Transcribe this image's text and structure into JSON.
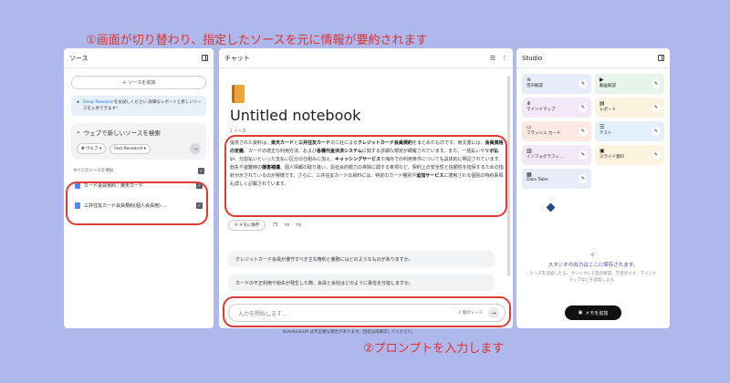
{
  "captions": {
    "top": "①画面が切り替わり、指定したソースを元に情報が要約されます",
    "bottom": "②プロンプトを入力します"
  },
  "sources_panel": {
    "title": "ソース",
    "add_button": "＋ ソースを追加",
    "deep_research": {
      "link": "Deep Research",
      "text": "をお試しください 詳細なレポートと新しいソースを入手できます！"
    },
    "search_title": "ウェブで新しいソースを検索",
    "web_chip": "ウェブ",
    "research_chip": "Fast Research",
    "select_all": "すべてのソースを選択",
    "items": [
      {
        "label": "カード会員規約｜楽天カード"
      },
      {
        "label": "三井住友カード会員規約(個人会員用) ..."
      }
    ]
  },
  "chat_panel": {
    "title": "チャット",
    "notebook_title": "Untitled notebook",
    "source_count": "2 ソース",
    "summary_html": "提供された資料は、<b>楽天カード</b>と<b>三井住友カード</b>の二社による<b>クレジットカード会員規約</b>をまとめたものです。両文書には、<b>会員資格の定義</b>、カードの適正な利用方法、および<b>各種代金決済システム</b>に関する詳細な規定が網羅されています。また、一括払いや<b>リボ払い</b>、分割払いといった支払い区分の仕組みに加え、<b>キャッシングサービス</b>や海外での利用条件についても具体的に明記されています。紛失や盗難時の<b>損害補償</b>、個人情報の取り扱い、反社会的勢力の排除に関する条項など、契約上の安全性と信頼性を担保するための指針が示されているのが特徴です。さらに、三井住友カードの資料には、特定のカード種別や<b>追加サービス</b>に適用される個別の特約事項も詳しく記載されています。",
    "save_memo": "メモに保存",
    "questions": [
      "クレジットカード会員が遵守すべき主な権利と義務にはどのようなものがありますか。",
      "カードの不正利用や紛失が発生した際、会員と会社はどのように責任を分担しますか。"
    ],
    "input_placeholder": "入力を開始します...",
    "input_count": "2 個のソース"
  },
  "studio_panel": {
    "title": "Studio",
    "tiles": [
      {
        "icon": "waveform-icon",
        "label": "音声解説",
        "color": "#e8ecf8"
      },
      {
        "icon": "video-icon",
        "label": "動画解説",
        "color": "#e6f4ea"
      },
      {
        "icon": "mindmap-icon",
        "label": "マインドマップ",
        "color": "#f3e8f7"
      },
      {
        "icon": "report-icon",
        "label": "レポート",
        "color": "#fbf3dd"
      },
      {
        "icon": "flashcard-icon",
        "label": "フラッシュ カード",
        "color": "#fde8e4"
      },
      {
        "icon": "quiz-icon",
        "label": "テスト",
        "color": "#e3f0fb"
      },
      {
        "icon": "infographic-icon",
        "label": "インフォグラフィ...",
        "color": "#f3e8f7"
      },
      {
        "icon": "slides-icon",
        "label": "スライド資料",
        "color": "#fbf3dd"
      },
      {
        "icon": "table-icon",
        "label": "Data Table",
        "color": "#e8ecf8"
      }
    ],
    "saved_title": "スタジオの出力はここに保存されます。",
    "saved_desc": "ソースを追加したら、クリックして音声解説、学習ガイド、マインドマップなどを追加します。",
    "add_note": "メモを追加"
  },
  "footer": "NotebookLM は不正確な場合があります。回答は再確認してください。"
}
